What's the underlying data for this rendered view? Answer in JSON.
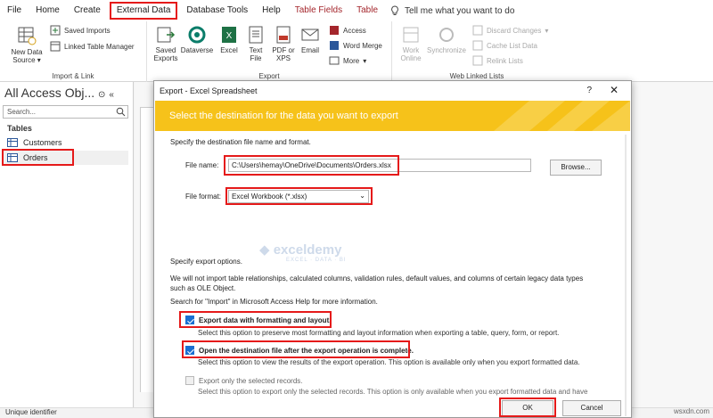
{
  "menu": {
    "items": [
      "File",
      "Home",
      "Create",
      "External Data",
      "Database Tools",
      "Help",
      "Table Fields",
      "Table"
    ],
    "search_text": "Tell me what you want to do"
  },
  "ribbon": {
    "import_link": {
      "new_data_source": "New Data Source",
      "saved_imports": "Saved Imports",
      "linked_table_manager": "Linked Table Manager",
      "label": "Import & Link"
    },
    "export": {
      "saved_exports": "Saved Exports",
      "dataverse": "Dataverse",
      "excel": "Excel",
      "text_file": "Text File",
      "pdf_xps": "PDF or XPS",
      "email": "Email",
      "access": "Access",
      "word_merge": "Word Merge",
      "more": "More",
      "label": "Export"
    },
    "web_linked_lists": {
      "work_online": "Work Online",
      "synchronize": "Synchronize",
      "discard_changes": "Discard Changes",
      "cache_list_data": "Cache List Data",
      "relink_lists": "Relink Lists",
      "label": "Web Linked Lists"
    }
  },
  "nav": {
    "title": "All Access Obj...",
    "search_placeholder": "Search...",
    "section": "Tables",
    "items": [
      "Customers",
      "Orders"
    ]
  },
  "dialog": {
    "title": "Export - Excel Spreadsheet",
    "help": "?",
    "banner": "Select the destination for the data you want to export",
    "specify_dest": "Specify the destination file name and format.",
    "file_name_label": "File name:",
    "file_name_value": "C:\\Users\\hemay\\OneDrive\\Documents\\Orders.xlsx",
    "browse": "Browse...",
    "file_format_label": "File format:",
    "file_format_value": "Excel Workbook (*.xlsx)",
    "specify_options": "Specify export options.",
    "import_note": "We will not import table relationships, calculated columns, validation rules, default values, and columns of certain legacy data types such as OLE Object.",
    "help_note": "Search for \"Import\" in Microsoft Access Help for more information.",
    "options": [
      {
        "label": "Export data with formatting and layout.",
        "desc": "Select this option to preserve most formatting and layout information when exporting a table, query, form, or report.",
        "checked": true
      },
      {
        "label": "Open the destination file after the export operation is complete.",
        "desc": "Select this option to view the results of the export operation. This option is available only when you export formatted data.",
        "checked": true
      },
      {
        "label": "Export only the selected records.",
        "desc": "Select this option to export only the selected records. This option is only available when you export formatted data and have",
        "checked": false
      }
    ],
    "ok": "OK",
    "cancel": "Cancel"
  },
  "status": {
    "left": "Unique identifier",
    "site": "wsxdn.com"
  },
  "watermark": {
    "name": "exceldemy",
    "tagline": "EXCEL · DATA · BI"
  },
  "colors": {
    "accent_red": "#e51a1a",
    "banner": "#f6c21a",
    "checkbox": "#1a6fd1"
  }
}
